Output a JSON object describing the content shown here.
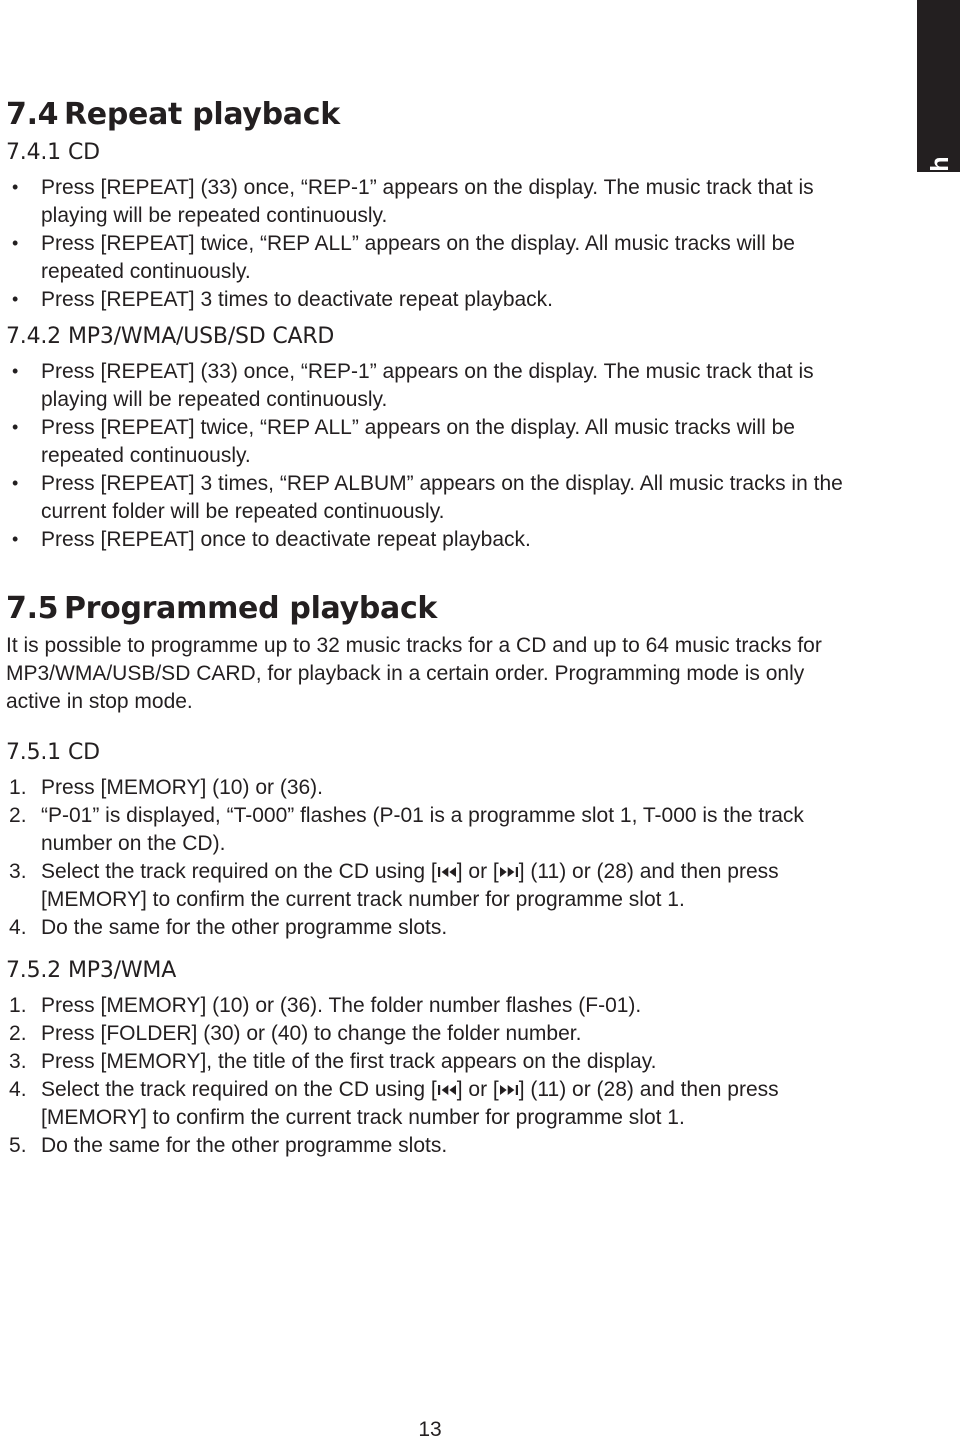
{
  "language_tab": {
    "label": "English"
  },
  "page_number": "13",
  "sections": [
    {
      "id": "repeat-playback",
      "number": "7.4",
      "title": "Repeat playback",
      "subsections": [
        {
          "id": "repeat-cd",
          "number": "7.4.1",
          "title": "CD",
          "list_type": "bullet",
          "items": [
            "Press [REPEAT] (33) once, “REP-1” appears on the display. The music track that is playing will be repeated continuously.",
            "Press [REPEAT] twice, “REP ALL” appears on the display. All music tracks will be repeated continuously.",
            "Press [REPEAT] 3 times to deactivate repeat playback."
          ]
        },
        {
          "id": "repeat-mp3",
          "number": "7.4.2",
          "title": "MP3/WMA/USB/SD CARD",
          "list_type": "bullet",
          "items": [
            "Press [REPEAT] (33) once, “REP-1” appears on the display. The music track that is playing will be repeated continuously.",
            "Press [REPEAT] twice, “REP ALL” appears on the display. All music tracks will be repeated continuously.",
            "Press [REPEAT] 3 times, “REP ALBUM” appears on the display. All music tracks in the current folder will be repeated continuously.",
            "Press [REPEAT] once to deactivate repeat playback."
          ]
        }
      ]
    },
    {
      "id": "programmed-playback",
      "number": "7.5",
      "title": "Programmed playback",
      "intro": "It is possible to programme up to 32 music tracks for a CD and up to 64 music tracks for MP3/WMA/USB/SD CARD, for playback in a certain order. Programming mode is only active in stop mode.",
      "subsections": [
        {
          "id": "programmed-cd",
          "number": "7.5.1",
          "title": "CD",
          "list_type": "numbered",
          "items": [
            {
              "parts": [
                {
                  "text": "Press [MEMORY] (10) or (36)."
                }
              ]
            },
            {
              "parts": [
                {
                  "text": "“P-01” is displayed, “T-000” flashes (P-01 is a programme slot 1, T-000 is the track number on the CD)."
                }
              ]
            },
            {
              "parts": [
                {
                  "text": "Select the track required on the CD using ["
                },
                {
                  "icon": "skip-backward-icon"
                },
                {
                  "text": "] or ["
                },
                {
                  "icon": "skip-forward-icon"
                },
                {
                  "text": "] (11) or (28) and then press [MEMORY] to confirm the current track number for programme slot 1."
                }
              ]
            },
            {
              "parts": [
                {
                  "text": "Do the same for the other programme slots."
                }
              ]
            }
          ]
        },
        {
          "id": "programmed-mp3",
          "number": "7.5.2",
          "title": "MP3/WMA",
          "list_type": "numbered",
          "items": [
            {
              "parts": [
                {
                  "text": "Press [MEMORY] (10) or (36). The folder number flashes (F-01)."
                }
              ]
            },
            {
              "parts": [
                {
                  "text": "Press [FOLDER] (30) or (40) to change the folder number."
                }
              ]
            },
            {
              "parts": [
                {
                  "text": "Press [MEMORY], the title of the first track appears on the display."
                }
              ]
            },
            {
              "parts": [
                {
                  "text": "Select the track required on the CD using ["
                },
                {
                  "icon": "skip-backward-icon"
                },
                {
                  "text": "] or ["
                },
                {
                  "icon": "skip-forward-icon"
                },
                {
                  "text": "] (11) or (28) and then press [MEMORY] to confirm the current track number for programme slot 1."
                }
              ]
            },
            {
              "parts": [
                {
                  "text": "Do the same for the other programme slots."
                }
              ]
            }
          ]
        }
      ]
    }
  ],
  "colors": {
    "text": "#231f20",
    "tab_background": "#231f20",
    "tab_text": "#ffffff",
    "page_background": "#ffffff"
  }
}
